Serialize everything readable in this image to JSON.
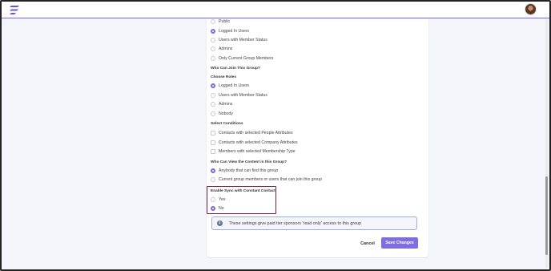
{
  "app": {
    "logo_icon": "bolt-logo-icon",
    "avatar_icon": "user-avatar",
    "accent": "#7b68d8"
  },
  "visibility_options": [
    {
      "label": "Public",
      "selected": false
    },
    {
      "label": "Logged In Users",
      "selected": true
    },
    {
      "label": "Users with Member Status",
      "selected": false
    },
    {
      "label": "Admins",
      "selected": false
    },
    {
      "label": "Only Current Group Members",
      "selected": false
    }
  ],
  "join": {
    "heading": "Who Can Join This Group?",
    "roles_heading": "Choose Roles",
    "roles": [
      {
        "label": "Logged In Users",
        "selected": true
      },
      {
        "label": "Users with Member Status",
        "selected": false
      },
      {
        "label": "Admins",
        "selected": false
      },
      {
        "label": "Nobody",
        "selected": false
      }
    ],
    "conditions_heading": "Select Conditions",
    "conditions": [
      {
        "label": "Contacts with selected People Attributes",
        "checked": false
      },
      {
        "label": "Contacts with selected Company Attributes",
        "checked": false
      },
      {
        "label": "Members with selected Membership Type",
        "checked": false
      }
    ]
  },
  "content_view": {
    "heading": "Who Can View the Content in this Group?",
    "options": [
      {
        "label": "Anybody that can find this group",
        "selected": true
      },
      {
        "label": "Current group members or users that can join this group",
        "selected": false
      }
    ]
  },
  "sync": {
    "heading": "Enable Sync with Constant Contact",
    "options": [
      {
        "label": "Yes",
        "selected": false
      },
      {
        "label": "No",
        "selected": true
      }
    ]
  },
  "info": {
    "icon": "info-icon",
    "text": "These settings give paid tier sponsors 'read only' access to this group"
  },
  "actions": {
    "cancel_label": "Cancel",
    "save_label": "Save Changes"
  }
}
